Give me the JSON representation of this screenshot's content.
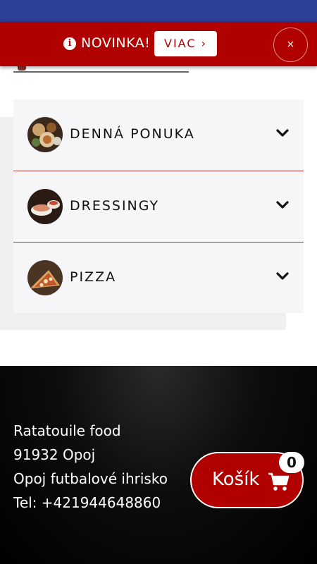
{
  "notice": {
    "icon": "info-icon",
    "text": "NOVINKA!",
    "more_label": "VIAC ›",
    "close_label": "×"
  },
  "menu": {
    "categories": [
      {
        "label": "DENNÁ PONUKA",
        "icon": "chevron-down-icon"
      },
      {
        "label": "DRESSINGY",
        "icon": "chevron-down-icon"
      },
      {
        "label": "PIZZA",
        "icon": "chevron-down-icon"
      }
    ]
  },
  "footer": {
    "name": "Ratatouile food",
    "postal_city": "91932 Opoj",
    "address": "Opoj futbalové ihrisko",
    "phone": "Tel: +421944648860"
  },
  "cart": {
    "label": "Košík",
    "icon": "cart-icon",
    "count": "0"
  },
  "colors": {
    "top_strip": "#2e3f96",
    "brand_red": "#b00000",
    "divider": "#a83a3a"
  }
}
